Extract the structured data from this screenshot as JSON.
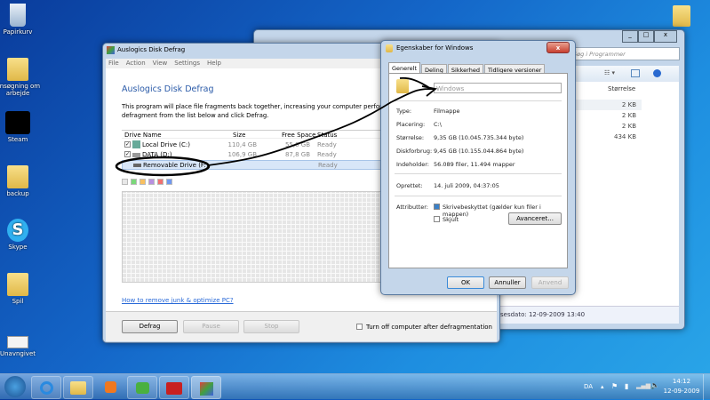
{
  "desktop": {
    "icons": [
      {
        "label": "Papirkurv",
        "icon": "recycle-bin-icon"
      },
      {
        "label": "Ansøgning om arbejde",
        "icon": "folder-icon"
      },
      {
        "label": "Steam",
        "icon": "steam-icon"
      },
      {
        "label": "backup",
        "icon": "folder-icon"
      },
      {
        "label": "Skype",
        "icon": "skype-icon"
      },
      {
        "label": "Spil",
        "icon": "folder-icon"
      },
      {
        "label": "Unavngivet",
        "icon": "document-icon"
      }
    ]
  },
  "explorer": {
    "search_placeholder": "Søg i Programmer",
    "column": "Størrelse",
    "sizes": [
      "2 KB",
      "2 KB",
      "2 KB",
      "434 KB"
    ],
    "status": "telsesdato: 12-09-2009 13:40"
  },
  "defrag": {
    "title": "Auslogics Disk Defrag",
    "menu": [
      "File",
      "Action",
      "View",
      "Settings",
      "Help"
    ],
    "heading": "Auslogics Disk Defrag",
    "description": "This program will place file fragments back together, increasing your computer performance. Select a drive to defragment from the list below and click Defrag.",
    "columns": [
      "Drive Name",
      "Size",
      "Free Space",
      "Status"
    ],
    "drives": [
      {
        "name": "Local Drive (C:)",
        "size": "110,4 GB",
        "free": "55,0 GB",
        "status": "Ready",
        "checked": true
      },
      {
        "name": "DATA (D:)",
        "size": "106,9 GB",
        "free": "87,8 GB",
        "status": "Ready",
        "checked": true
      },
      {
        "name": "Removable Drive (F:)",
        "size": "",
        "free": "",
        "status": "Ready",
        "checked": false
      }
    ],
    "legend_colors": [
      "#e8e8e8",
      "#7ad87a",
      "#f8c060",
      "#b890e0",
      "#f07070",
      "#7098f0"
    ],
    "link": "How to remove junk & optimize PC?",
    "buttons": {
      "defrag": "Defrag",
      "pause": "Pause",
      "stop": "Stop"
    },
    "shutdown_label": "Turn off computer after defragmentation"
  },
  "props": {
    "title": "Egenskaber for Windows",
    "tabs": [
      "Generelt",
      "Deling",
      "Sikkerhed",
      "Tidligere versioner"
    ],
    "name_value": "Windows",
    "rows": [
      {
        "label": "Type:",
        "value": "Filmappe"
      },
      {
        "label": "Placering:",
        "value": "C:\\"
      },
      {
        "label": "Størrelse:",
        "value": "9,35 GB (10.045.735.344 byte)"
      },
      {
        "label": "Diskforbrug:",
        "value": "9,45 GB (10.155.044.864 byte)"
      },
      {
        "label": "Indeholder:",
        "value": "56.089 filer, 11.494 mapper"
      }
    ],
    "created_label": "Oprettet:",
    "created_value": "14. juli 2009, 04:37:05",
    "attr_label": "Attributter:",
    "readonly": "Skrivebeskyttet (gælder kun filer i mappen)",
    "hidden": "Skjult",
    "advanced": "Avanceret...",
    "ok": "OK",
    "cancel": "Annuller",
    "apply": "Anvend",
    "close": "x"
  },
  "taskbar": {
    "lang": "DA",
    "time": "14:12",
    "date": "12-09-2009"
  }
}
